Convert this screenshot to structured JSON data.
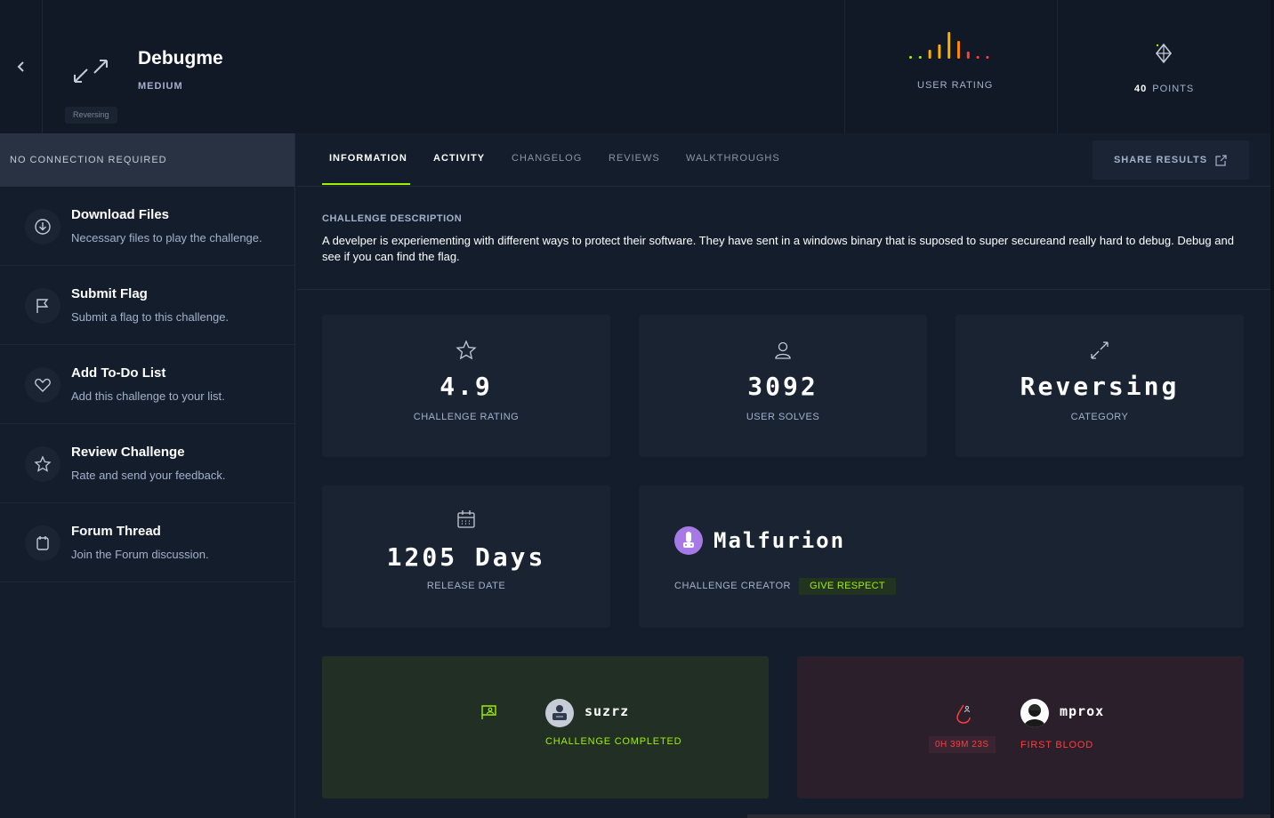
{
  "header": {
    "title": "Debugme",
    "difficulty": "MEDIUM",
    "tag": "Reversing",
    "user_rating_label": "USER RATING",
    "points_value": "40",
    "points_label": "POINTS",
    "rating_colors": [
      "#9fef00",
      "#9fef00",
      "#ffaf00",
      "#ffaf00",
      "#ffaf00",
      "#ff8400",
      "#ff3e3e",
      "#ff3e3e",
      "#ff3e3e"
    ]
  },
  "sidebar": {
    "connection": "NO CONNECTION REQUIRED",
    "items": [
      {
        "title": "Download Files",
        "subtitle": "Necessary files to play the challenge.",
        "icon": "download-icon"
      },
      {
        "title": "Submit Flag",
        "subtitle": "Submit a flag to this challenge.",
        "icon": "flag-icon"
      },
      {
        "title": "Add To-Do List",
        "subtitle": "Add this challenge to your list.",
        "icon": "heart-icon"
      },
      {
        "title": "Review Challenge",
        "subtitle": "Rate and send your feedback.",
        "icon": "star-icon"
      },
      {
        "title": "Forum Thread",
        "subtitle": "Join the Forum discussion.",
        "icon": "forum-icon"
      }
    ]
  },
  "tabs": {
    "information": "INFORMATION",
    "activity": "ACTIVITY",
    "changelog": "CHANGELOG",
    "reviews": "REVIEWS",
    "walkthroughs": "WALKTHROUGHS",
    "share": "SHARE RESULTS"
  },
  "description": {
    "label": "CHALLENGE DESCRIPTION",
    "text": "A develper is experiementing with different ways to protect their software. They have sent in a windows binary that is suposed to super secureand really hard to debug. Debug and see if you can find the flag."
  },
  "stats": {
    "rating_value": "4.9",
    "rating_label": "CHALLENGE RATING",
    "solves_value": "3092",
    "solves_label": "USER SOLVES",
    "category_value": "Reversing",
    "category_label": "CATEGORY",
    "release_value": "1205 Days",
    "release_label": "RELEASE DATE"
  },
  "creator": {
    "name": "Malfurion",
    "label": "CHALLENGE CREATOR",
    "respect": "GIVE RESPECT"
  },
  "completion": {
    "user": "suzrz",
    "label": "CHALLENGE COMPLETED"
  },
  "first_blood": {
    "user": "mprox",
    "time": "0H 39M 23S",
    "label": "FIRST BLOOD"
  },
  "colors": {
    "accent": "#9fef00",
    "danger": "#ff3e3e",
    "bg": "#141d2b",
    "card": "#1a2332"
  }
}
